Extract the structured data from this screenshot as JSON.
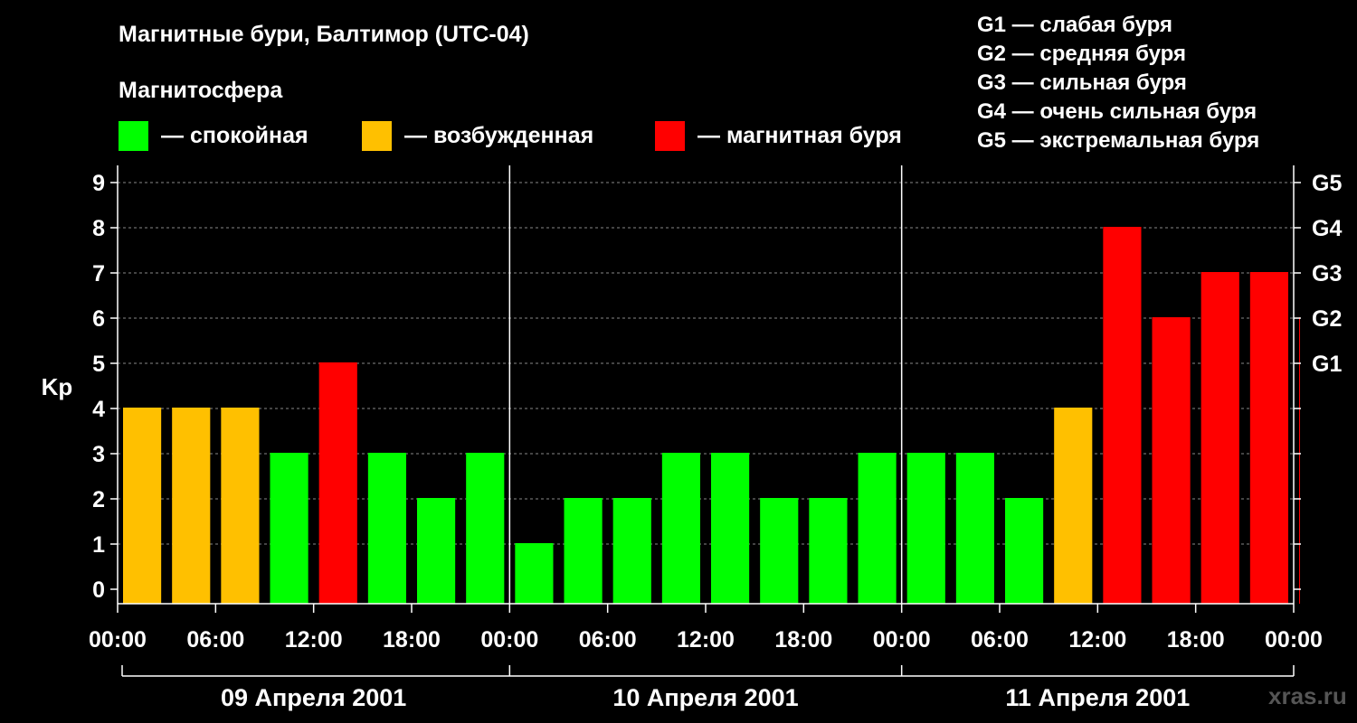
{
  "header": {
    "title": "Магнитные бури, Балтимор (UTC-04)",
    "subtitle": "Магнитосфера"
  },
  "legend": [
    {
      "label": "— спокойная",
      "color": "#00ff00"
    },
    {
      "label": "— возбужденная",
      "color": "#ffc000"
    },
    {
      "label": "— магнитная буря",
      "color": "#ff0000"
    }
  ],
  "g_legend": [
    "G1 — слабая буря",
    "G2 — средняя буря",
    "G3 — сильная буря",
    "G4 — очень сильная буря",
    "G5 — экстремальная буря"
  ],
  "watermark": "xras.ru",
  "chart_data": {
    "type": "bar",
    "ylabel": "Kp",
    "ylim": [
      0,
      9
    ],
    "y_ticks": [
      0,
      1,
      2,
      3,
      4,
      5,
      6,
      7,
      8,
      9
    ],
    "g_scale": [
      {
        "kp": 5,
        "label": "G1"
      },
      {
        "kp": 6,
        "label": "G2"
      },
      {
        "kp": 7,
        "label": "G3"
      },
      {
        "kp": 8,
        "label": "G4"
      },
      {
        "kp": 9,
        "label": "G5"
      }
    ],
    "x_tick_labels": [
      "00:00",
      "06:00",
      "12:00",
      "18:00",
      "00:00",
      "06:00",
      "12:00",
      "18:00",
      "00:00",
      "06:00",
      "12:00",
      "18:00",
      "00:00"
    ],
    "days": [
      "09 Апреля 2001",
      "10 Апреля 2001",
      "11 Апреля 2001"
    ],
    "interval_hours": 3,
    "values": [
      4,
      4,
      4,
      3,
      5,
      3,
      2,
      3,
      1,
      2,
      2,
      3,
      3,
      2,
      2,
      3,
      3,
      3,
      2,
      4,
      8,
      6,
      7,
      7,
      6
    ],
    "colors": {
      "quiet": "#00ff00",
      "unsettled": "#ffc000",
      "storm": "#ff0000"
    },
    "grid": true
  }
}
